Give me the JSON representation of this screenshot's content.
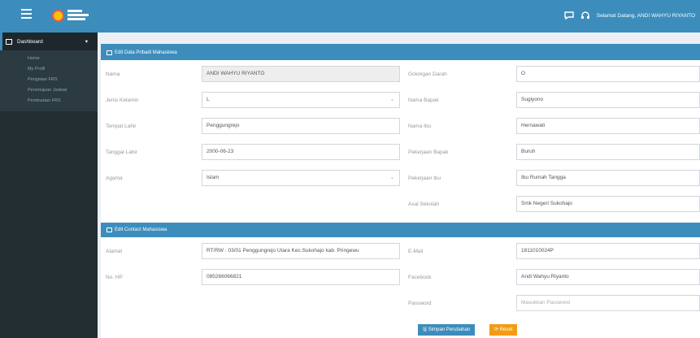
{
  "header": {
    "user_welcome": "Selamat Datang, ANDI WAHYU RIYANTO"
  },
  "sidebar": {
    "dashboard": "Dashboard",
    "items": [
      "Home",
      "My Profil",
      "Pengisian FRS",
      "Persetujuan Jadwal",
      "Pembuatan FRS"
    ]
  },
  "personal": {
    "title": "Edit Data Pribadi Mahasiswa",
    "fields": {
      "nama": {
        "label": "Nama",
        "value": "ANDI WAHYU RIYANTO"
      },
      "golongan_darah": {
        "label": "Golongan Darah",
        "value": "O"
      },
      "jenis_kelamin": {
        "label": "Jenis Kelamin",
        "value": "L"
      },
      "nama_bapak": {
        "label": "Nama Bapak",
        "value": "Sugiyono"
      },
      "tempat_lahir": {
        "label": "Tempat Lahir",
        "value": "Penggungrejo"
      },
      "nama_ibu": {
        "label": "Nama Ibu",
        "value": "Hernawati"
      },
      "tanggal_lahir": {
        "label": "Tanggal Lahir",
        "value": "2000-06-23"
      },
      "pekerjaan_bapak": {
        "label": "Pekerjaan Bapak",
        "value": "Buruh"
      },
      "agama": {
        "label": "Agama",
        "value": "Islam"
      },
      "pekerjaan_ibu": {
        "label": "Pekerjaan Ibu",
        "value": "Ibu Rumah Tangga"
      },
      "asal_sekolah": {
        "label": "Asal Sekolah",
        "value": "Smk Negeri Sukohajo"
      }
    }
  },
  "contact": {
    "title": "Edit Contact Mahasiswa",
    "fields": {
      "alamat": {
        "label": "Alamat",
        "value": "RT/RW : 03/01 Penggungrejo Utara Kec.Sukohajo kab. Pringewu"
      },
      "email": {
        "label": "E-Mail",
        "value": "1811010024P"
      },
      "no_hp": {
        "label": "No. HP",
        "value": "085266066821"
      },
      "facebook": {
        "label": "Facebook",
        "value": "Andi Wahyu Riyanto"
      },
      "password": {
        "label": "Password",
        "placeholder": "Masukkan Password"
      }
    }
  },
  "buttons": {
    "save": "Simpan Perubahan",
    "reset": "Reset"
  }
}
